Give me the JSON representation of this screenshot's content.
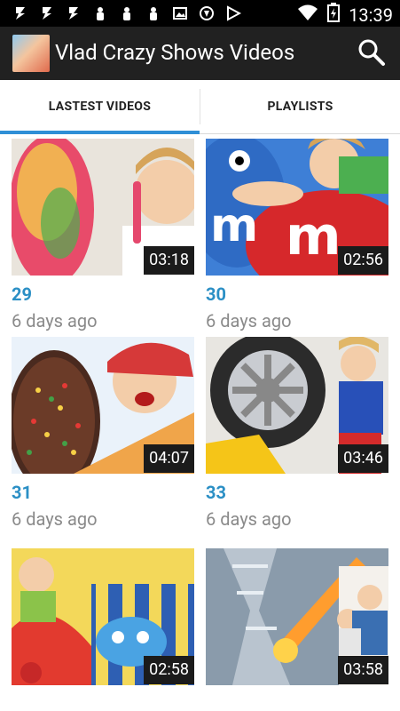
{
  "status_bar": {
    "time": "13:39",
    "icons": [
      "usb-icon",
      "usb-icon",
      "usb-icon",
      "battery-saver-icon",
      "battery-saver-icon",
      "battery-saver-icon",
      "image-icon",
      "shield-icon",
      "play-store-icon",
      "wifi-icon",
      "battery-charging-icon"
    ]
  },
  "app_bar": {
    "title": "Vlad Crazy Shows Videos",
    "search_icon": "search-icon"
  },
  "tabs": [
    {
      "label": "LASTEST VIDEOS",
      "selected": true
    },
    {
      "label": "PLAYLISTS",
      "selected": false
    }
  ],
  "accent": {
    "tab_indicator": "#2f8fd6",
    "video_title": "#2b8fc5",
    "app_bar": "#212121",
    "status_bar": "#000000"
  },
  "videos": [
    {
      "title": "29",
      "age": "6 days ago",
      "duration": "03:18"
    },
    {
      "title": "30",
      "age": "6 days ago",
      "duration": "02:56"
    },
    {
      "title": "31",
      "age": "6 days ago",
      "duration": "04:07"
    },
    {
      "title": "33",
      "age": "6 days ago",
      "duration": "03:46"
    },
    {
      "title": "",
      "age": "",
      "duration": "02:58"
    },
    {
      "title": "",
      "age": "",
      "duration": "03:58"
    }
  ]
}
